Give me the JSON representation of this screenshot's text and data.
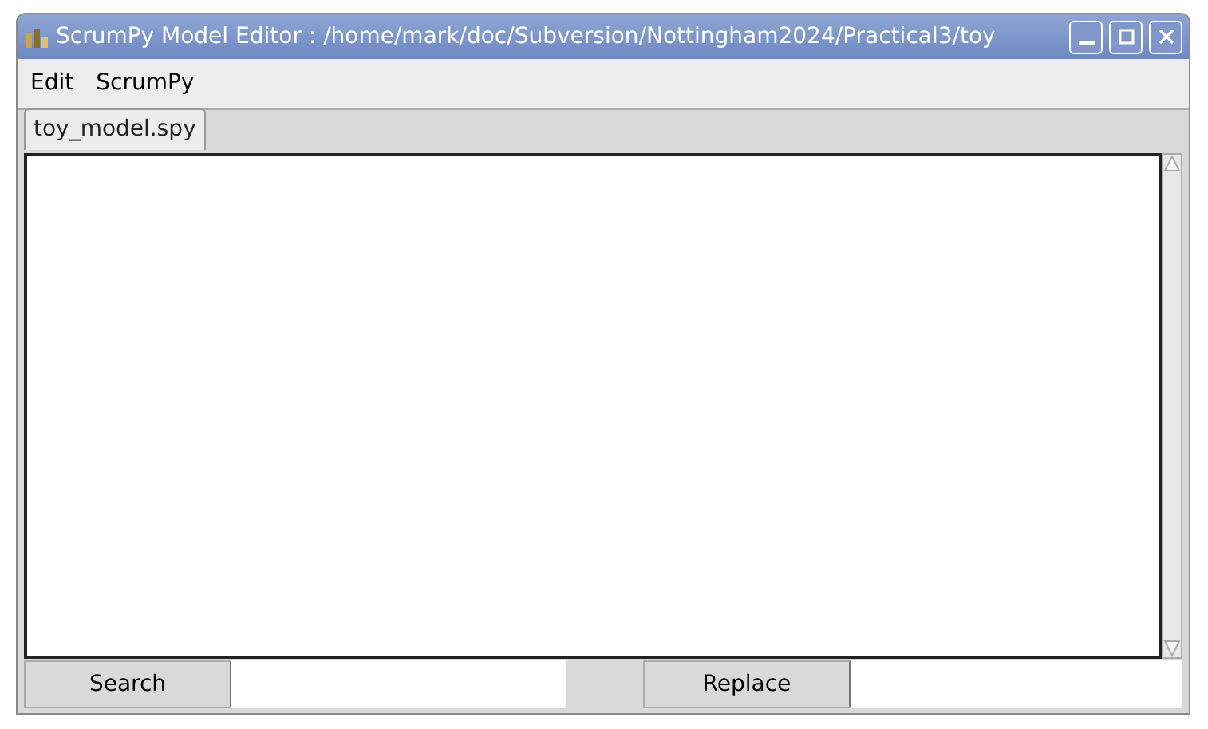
{
  "window": {
    "title": "ScrumPy Model Editor : /home/mark/doc/Subversion/Nottingham2024/Practical3/toy"
  },
  "menu": [
    "Edit",
    "ScrumPy"
  ],
  "tabs": [
    {
      "label": "toy_model.spy",
      "selected": true
    }
  ],
  "bottom": {
    "search_button": "Search",
    "replace_button": "Replace"
  }
}
